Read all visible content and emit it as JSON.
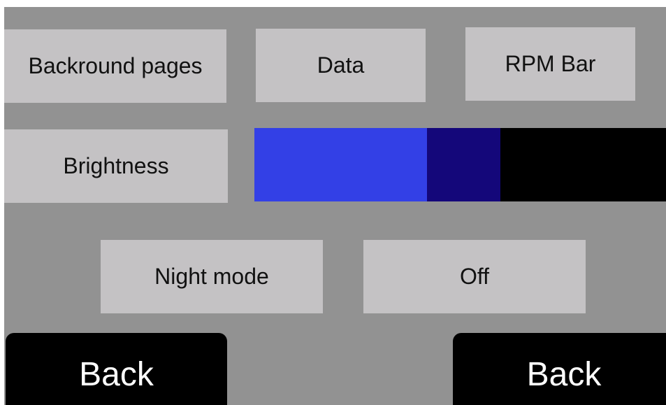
{
  "colors": {
    "background": "#929292",
    "button": "#c4c2c4",
    "slider_fill": "#3340e6",
    "slider_knob": "#14077a",
    "slider_track": "#000000",
    "back_button": "#000000"
  },
  "menu": {
    "background_pages_label": "Backround pages",
    "data_label": "Data",
    "rpm_bar_label": "RPM Bar"
  },
  "brightness": {
    "label": "Brightness",
    "level": 0.42
  },
  "night_mode": {
    "label": "Night mode",
    "value": "Off"
  },
  "nav": {
    "back_left_label": "Back",
    "back_right_label": "Back"
  }
}
